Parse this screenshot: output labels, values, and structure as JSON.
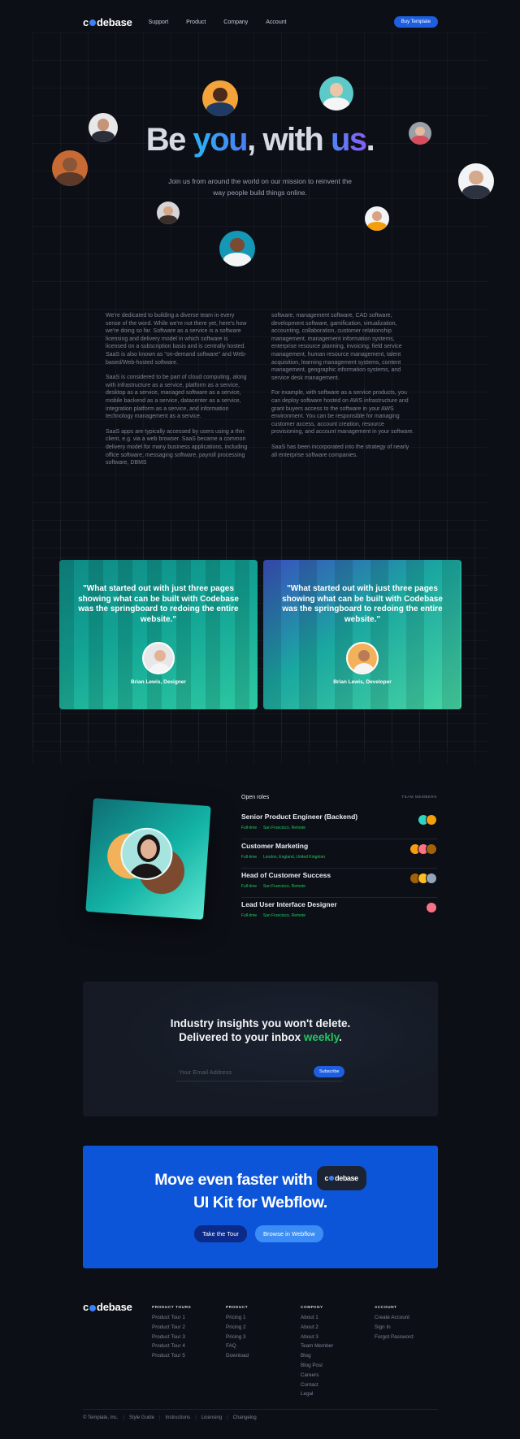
{
  "nav": {
    "logo": "codebase",
    "links": [
      "Support",
      "Product",
      "Company",
      "Account"
    ],
    "cta": "Buy Template"
  },
  "hero": {
    "title_part1": "Be ",
    "title_you": "you",
    "title_part2": ", with ",
    "title_us": "us",
    "title_end": ".",
    "subtitle": "Join us from around the world on our mission to reinvent the way people build things online."
  },
  "about": {
    "left": [
      "We're dedicated to building a diverse team in every sense of the word. While we're not there yet, here's how we're doing so far. Software as a service is a software licensing and delivery model in which software is licensed on a subscription basis and is centrally hosted. SaaS is also known as \"on-demand software\" and Web-based/Web-hosted software.",
      "SaaS is considered to be part of cloud computing, along with infrastructure as a service, platform as a service, desktop as a service, managed software as a service, mobile backend as a service, datacenter as a service, integration platform as a service, and information technology management as a service.",
      "SaaS apps are typically accessed by users using a thin client, e.g. via a web browser. SaaS became a common delivery model for many business applications, including office software, messaging software, payroll processing software, DBMS"
    ],
    "right": [
      "software, management software, CAD software, development software, gamification, virtualization, accounting, collaboration, customer relationship management, management information systems, enterprise resource planning, invoicing, field service management, human resource management, talent acquisition, learning management systems, content management, geographic information systems, and service desk management.",
      "For example, with software as a service products, you can deploy software hosted on AWS infrastructure and grant buyers access to the software in your AWS environment. You can be responsible for managing customer access, account creation, resource provisioning, and account management in your software.",
      "SaaS has been incorporated into the strategy of nearly all enterprise software companies."
    ]
  },
  "testimonials": [
    {
      "quote": "\"What started out with just three pages showing what can be built with Codebase was the springboard to redoing the entire website.\"",
      "name": "Brian Lewis, Designer"
    },
    {
      "quote": "\"What started out with just three pages showing what can be built with Codebase was the springboard to redoing the entire website.\"",
      "name": "Brian Lewis, Developer"
    }
  ],
  "roles": {
    "heading": "Open roles",
    "team_label": "TEAM MEMBERS",
    "items": [
      {
        "title": "Senior Product Engineer (Backend)",
        "type": "Full-time",
        "location": "San Francisco, Remote",
        "avatars": [
          "#2dd4bf",
          "#f59e0b"
        ]
      },
      {
        "title": "Customer Marketing",
        "type": "Full-time",
        "location": "London, England, United Kingdom",
        "avatars": [
          "#f59e0b",
          "#fb7185",
          "#a16207"
        ]
      },
      {
        "title": "Head of Customer Success",
        "type": "Full-time",
        "location": "San Francisco, Remote",
        "avatars": [
          "#a16207",
          "#fbbf24",
          "#94a3b8"
        ]
      },
      {
        "title": "Lead User Interface Designer",
        "type": "Full-time",
        "location": "San Francisco, Remote",
        "avatars": [
          "#fb7185"
        ]
      }
    ]
  },
  "newsletter": {
    "line1": "Industry insights you won't delete.",
    "line2": "Delivered to your inbox ",
    "highlight": "weekly",
    "line2_end": ".",
    "placeholder": "Your Email Address",
    "button": "Subscribe"
  },
  "cta": {
    "line1": "Move even faster with ",
    "pill": "codebase",
    "line2": "UI Kit for Webflow.",
    "button1": "Take the Tour",
    "button2": "Browse in Webflow"
  },
  "footer": {
    "logo": "codebase",
    "columns": [
      {
        "heading": "PRODUCT TOURS",
        "items": [
          "Product Tour 1",
          "Product Tour 2",
          "Product Tour 3",
          "Product Tour 4",
          "Product Tour 5"
        ]
      },
      {
        "heading": "PRODUCT",
        "items": [
          "Pricing 1",
          "Pricing 2",
          "Pricing 3",
          "FAQ",
          "Download"
        ]
      },
      {
        "heading": "COMPANY",
        "items": [
          "About 1",
          "About 2",
          "About 3",
          "Team Member",
          "Blog",
          "Blog Post",
          "Careers",
          "Contact",
          "Legal"
        ]
      },
      {
        "heading": "ACCOUNT",
        "items": [
          "Create Account",
          "Sign In",
          "Forgot Password"
        ]
      }
    ],
    "bottom": [
      "© Template, Inc.",
      "Style Guide",
      "Instructions",
      "Licensing",
      "Changelog"
    ]
  },
  "colors": {
    "background": "#0c0f16",
    "accent_blue": "#1d5fe0",
    "accent_green": "#22c55e",
    "cta_blue": "#0d55d8"
  }
}
